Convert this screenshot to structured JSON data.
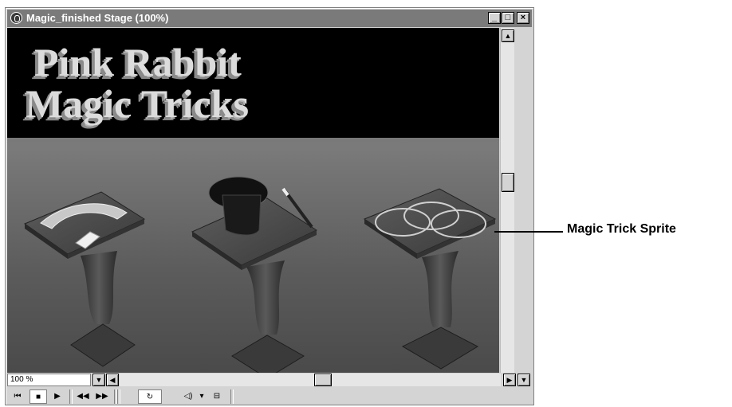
{
  "window": {
    "title": "Magic_finished Stage (100%)",
    "controls": {
      "minimize": "_",
      "maximize": "□",
      "close": "×"
    }
  },
  "stage": {
    "banner_line1": "Pink Rabbit",
    "banner_line2": "Magic Tricks",
    "tables": [
      "cards-table",
      "top-hat-table",
      "rings-table"
    ]
  },
  "statusbar": {
    "zoom_value": "100 %"
  },
  "callout": {
    "label": "Magic Trick Sprite"
  },
  "icons": {
    "rewind": "rewind-icon",
    "stop": "stop-icon",
    "play": "play-icon",
    "step_back": "step-back-icon",
    "step_forward": "step-forward-icon",
    "loop": "loop-icon",
    "volume": "volume-icon",
    "selected_frames": "selected-frames-icon"
  },
  "colors": {
    "banner_bg": "#000000",
    "banner_text": "#dcdcdc",
    "titlebar": "#7a7a7a",
    "chrome": "#d4d4d4"
  }
}
